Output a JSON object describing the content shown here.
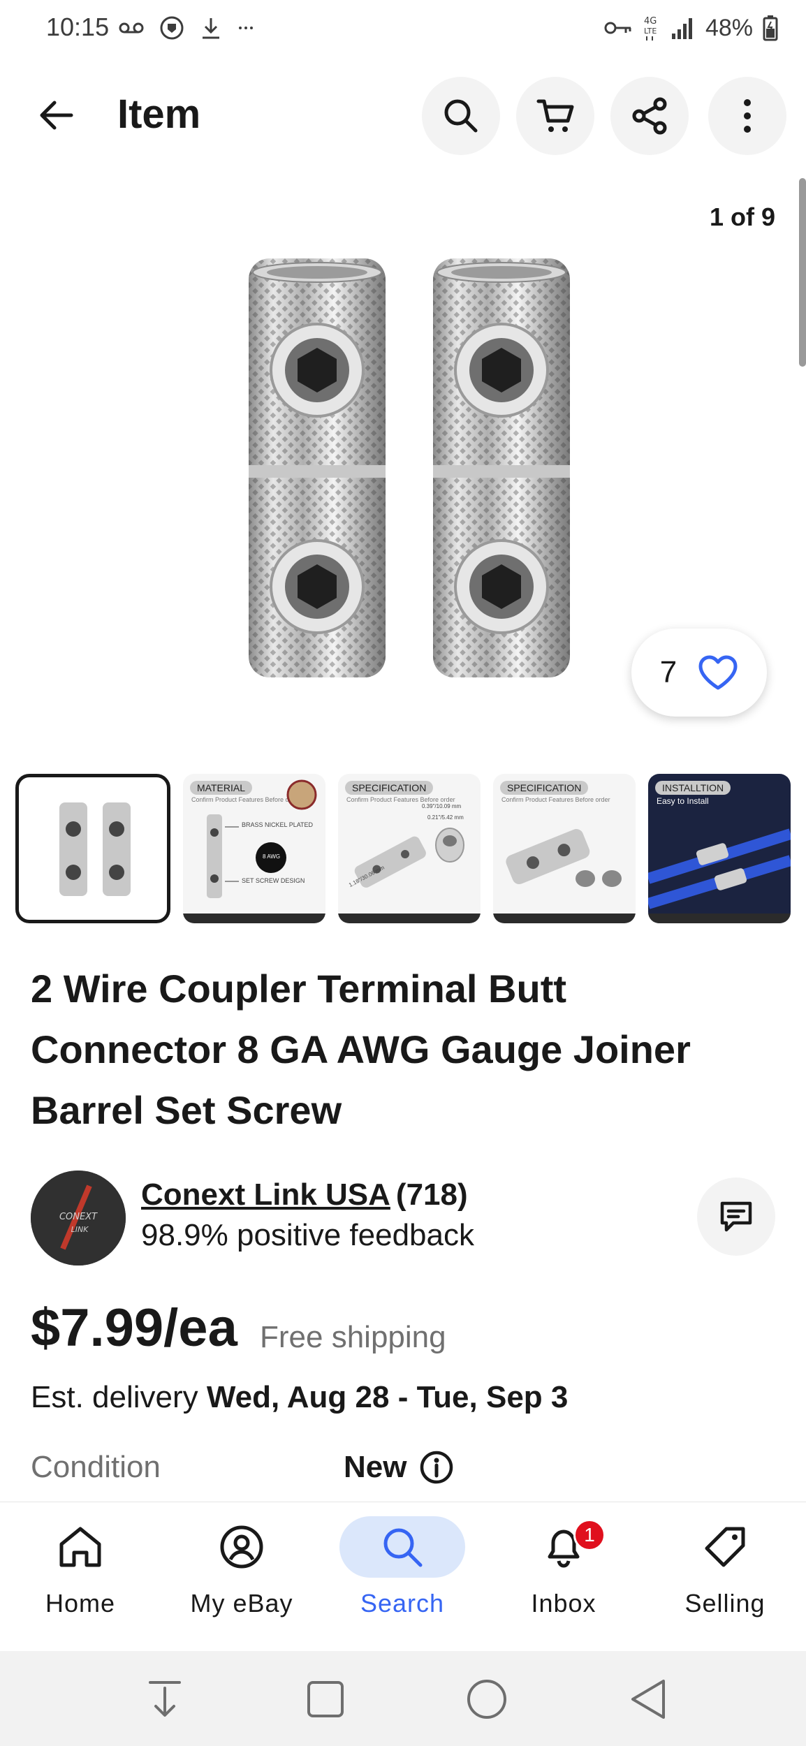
{
  "status_bar": {
    "time": "10:15",
    "battery": "48%",
    "icons_left": [
      "voicemail-icon",
      "shield-icon",
      "download-icon",
      "more-dots-icon"
    ],
    "icons_right": [
      "key-icon",
      "lte-icon",
      "signal-icon",
      "battery-icon"
    ]
  },
  "header": {
    "title": "Item",
    "buttons": [
      "search-icon",
      "cart-icon",
      "share-icon",
      "more-vertical-icon"
    ]
  },
  "gallery": {
    "counter": "1 of 9",
    "watch_count": "7"
  },
  "thumbnails": [
    {
      "label": ""
    },
    {
      "label": "MATERIAL",
      "sub": "Confirm Product Features Before order",
      "text1": "BRASS NICKEL PLATED",
      "text2": "SET SCREW DESIGN",
      "badge": "8 AWG"
    },
    {
      "label": "SPECIFICATION",
      "sub": "Confirm Product Features Before order",
      "dim1": "0.39\"/10.09 mm",
      "dim2": "0.21\"/5.42 mm",
      "dim3": "1.18\"/30.06 mm"
    },
    {
      "label": "SPECIFICATION",
      "sub": "Confirm Product Features Before order"
    },
    {
      "label": "INSTALLTION",
      "sub": "Easy to Install"
    }
  ],
  "item": {
    "title": "2 Wire Coupler Terminal Butt Connector 8 GA AWG Gauge Joiner Barrel Set Screw"
  },
  "seller": {
    "name": "Conext Link USA",
    "count": "(718)",
    "feedback": "98.9% positive feedback",
    "avatar_text": "CONEXT LINK"
  },
  "pricing": {
    "price": "$7.99/ea",
    "shipping": "Free shipping",
    "delivery_prefix": "Est. delivery ",
    "delivery_range": "Wed, Aug 28 - Tue, Sep 3"
  },
  "condition": {
    "label": "Condition",
    "value": "New"
  },
  "bottom_nav": {
    "items": [
      {
        "label": "Home",
        "icon": "home-icon"
      },
      {
        "label": "My eBay",
        "icon": "account-icon"
      },
      {
        "label": "Search",
        "icon": "search-icon"
      },
      {
        "label": "Inbox",
        "icon": "bell-icon",
        "badge": "1"
      },
      {
        "label": "Selling",
        "icon": "tag-icon"
      }
    ]
  },
  "colors": {
    "accent": "#3665f3",
    "active_bg": "#dbe7fb",
    "badge": "#e0101e",
    "text": "#191919",
    "muted": "#707070"
  }
}
